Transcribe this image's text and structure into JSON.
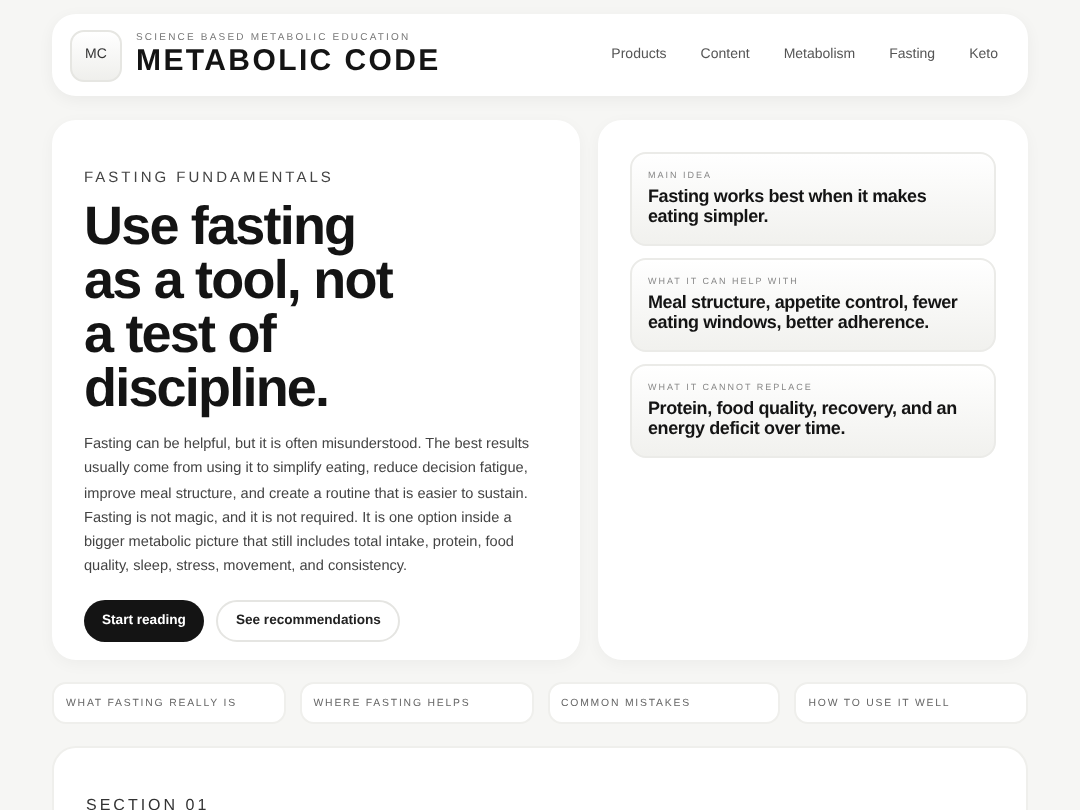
{
  "header": {
    "logo": "MC",
    "tagline": "SCIENCE BASED METABOLIC EDUCATION",
    "brand": "METABOLIC CODE",
    "nav": [
      "Products",
      "Content",
      "Metabolism",
      "Fasting",
      "Keto"
    ]
  },
  "hero": {
    "eyebrow": "FASTING FUNDAMENTALS",
    "title": "Use fasting as a tool, not a test of discipline.",
    "body": "Fasting can be helpful, but it is often misunderstood. The best results usually come from using it to simplify eating, reduce decision fatigue, improve meal structure, and create a routine that is easier to sustain. Fasting is not magic, and it is not required. It is one option inside a bigger metabolic picture that still includes total intake, protein, food quality, sleep, stress, movement, and consistency.",
    "buttons": [
      {
        "label": "Start reading",
        "kind": "primary"
      },
      {
        "label": "See recommendations",
        "kind": "secondary"
      }
    ]
  },
  "cards": [
    {
      "label": "MAIN IDEA",
      "text": "Fasting works best when it makes eating simpler."
    },
    {
      "label": "WHAT IT CAN HELP WITH",
      "text": "Meal structure, appetite control, fewer eating windows, better adherence."
    },
    {
      "label": "WHAT IT CANNOT REPLACE",
      "text": "Protein, food quality, recovery, and an energy deficit over time."
    }
  ],
  "chips": [
    "WHAT FASTING REALLY IS",
    "WHERE FASTING HELPS",
    "COMMON MISTAKES",
    "HOW TO USE IT WELL"
  ],
  "section": {
    "label": "SECTION 01"
  }
}
